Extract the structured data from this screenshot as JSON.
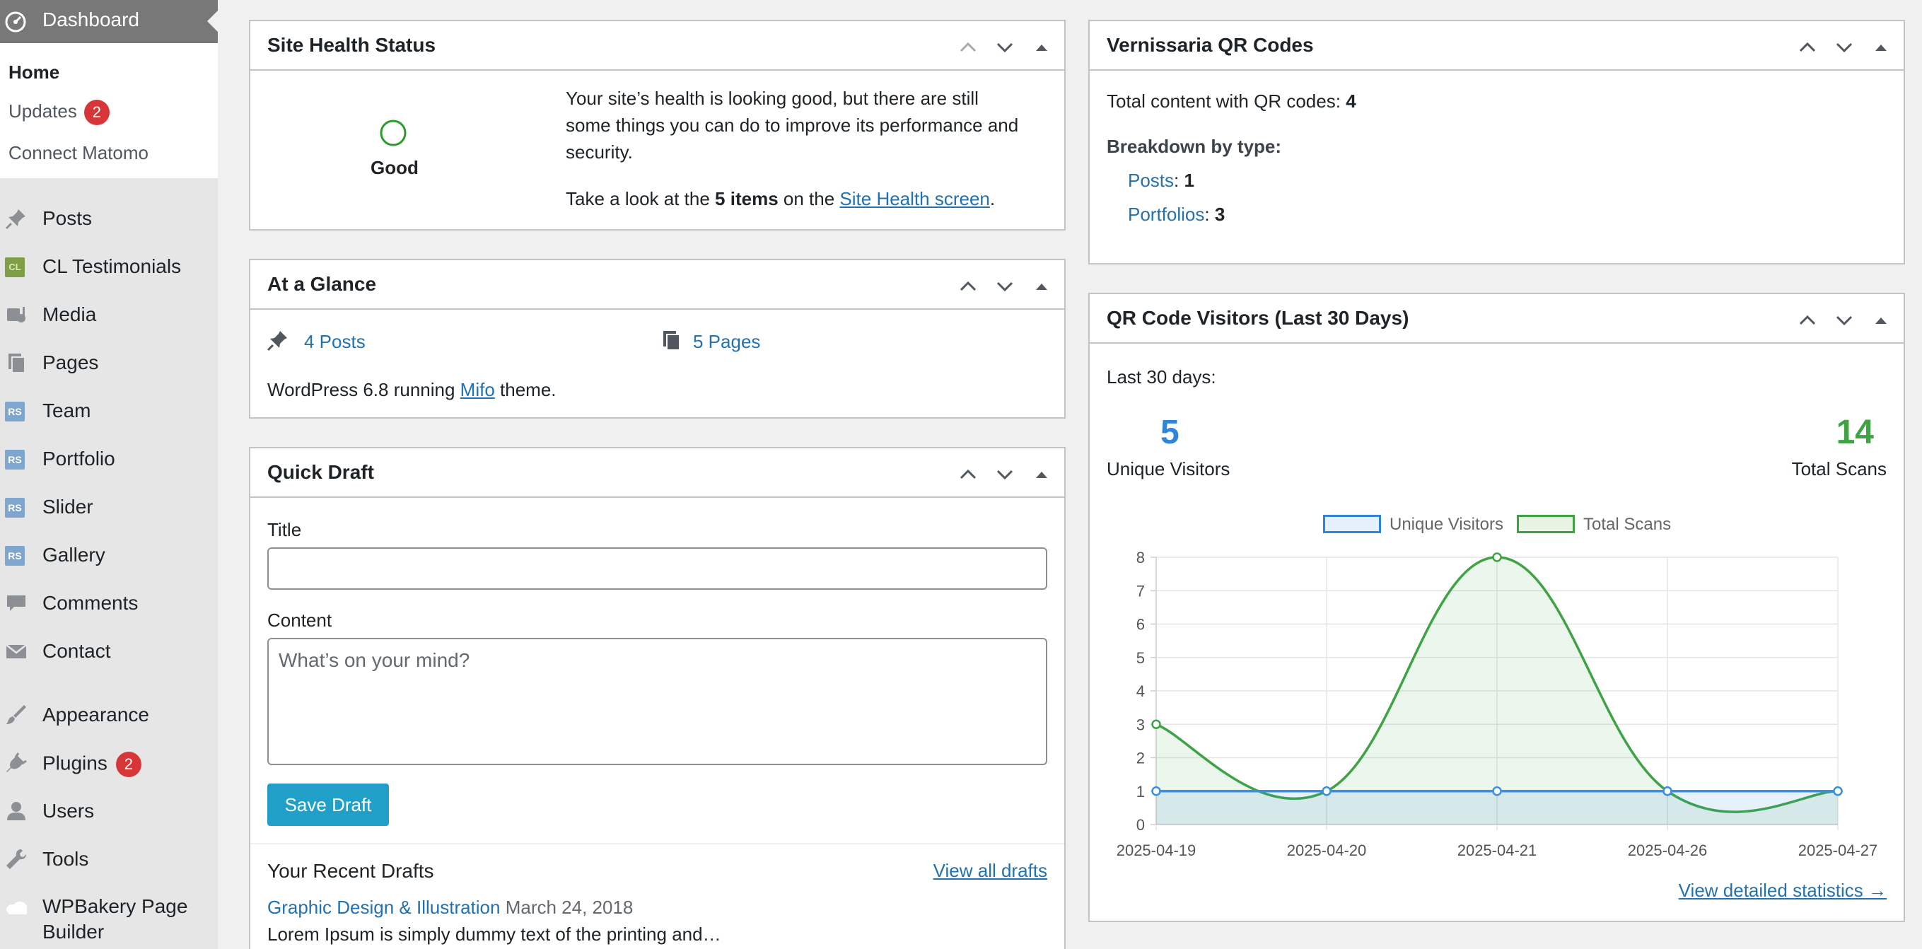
{
  "sidebar": {
    "dashboard_label": "Dashboard",
    "submenu": {
      "home": "Home",
      "updates": "Updates",
      "updates_count": "2",
      "connect_matomo": "Connect Matomo"
    },
    "items": [
      {
        "label": "Posts",
        "icon": "pin-icon"
      },
      {
        "label": "CL Testimonials",
        "icon": "cl-icon"
      },
      {
        "label": "Media",
        "icon": "media-icon"
      },
      {
        "label": "Pages",
        "icon": "pages-icon"
      },
      {
        "label": "Team",
        "icon": "rs-icon"
      },
      {
        "label": "Portfolio",
        "icon": "rs-icon"
      },
      {
        "label": "Slider",
        "icon": "rs-icon"
      },
      {
        "label": "Gallery",
        "icon": "rs-icon"
      },
      {
        "label": "Comments",
        "icon": "comment-icon"
      },
      {
        "label": "Contact",
        "icon": "mail-icon"
      },
      {
        "label": "Appearance",
        "icon": "brush-icon"
      },
      {
        "label": "Plugins",
        "icon": "plug-icon",
        "badge": "2"
      },
      {
        "label": "Users",
        "icon": "user-icon"
      },
      {
        "label": "Tools",
        "icon": "wrench-icon"
      },
      {
        "label": "WPBakery Page",
        "label2": "Builder",
        "icon": "cloud-icon"
      }
    ]
  },
  "site_health": {
    "title": "Site Health Status",
    "status": "Good",
    "message": [
      "Your site’s health is looking good, but there are still",
      "some things you can do to improve its performance and",
      "security."
    ],
    "take_look_prefix": "Take a look at the",
    "items_text": "5 items",
    "on_the": "on the",
    "screen_link": "Site Health screen",
    "period": "."
  },
  "at_a_glance": {
    "title": "At a Glance",
    "posts": "4 Posts",
    "pages": "5 Pages",
    "wp_prefix": "WordPress 6.8 running",
    "theme_link": "Mifo",
    "wp_suffix": "theme."
  },
  "quick_draft": {
    "title": "Quick Draft",
    "title_label": "Title",
    "title_value": "",
    "content_label": "Content",
    "content_placeholder": "What’s on your mind?",
    "save_button": "Save Draft",
    "recent_heading": "Your Recent Drafts",
    "view_all": "View all drafts",
    "draft_title": "Graphic Design & Illustration",
    "draft_date": "March 24, 2018",
    "draft_excerpt": "Lorem Ipsum is simply dummy text of the printing and…"
  },
  "qr_codes": {
    "title": "Vernissaria QR Codes",
    "total_label": "Total content with QR codes:",
    "total_value": "4",
    "breakdown_label": "Breakdown by type:",
    "posts_label": "Posts",
    "posts_value": "1",
    "portfolios_label": "Portfolios",
    "portfolios_value": "3",
    "colon": ":"
  },
  "qr_visitors": {
    "title": "QR Code Visitors (Last 30 Days)",
    "period_label": "Last 30 days:",
    "unique_value": "5",
    "unique_label": "Unique Visitors",
    "scans_value": "14",
    "scans_label": "Total Scans",
    "details_link": "View detailed statistics →"
  },
  "colors": {
    "accent_blue": "#2271b1",
    "badge_red": "#d63638",
    "chart_blue": "#3a8ee6",
    "chart_green": "#3fa345"
  },
  "chart_data": {
    "type": "line",
    "x": [
      "2025-04-19",
      "2025-04-20",
      "2025-04-21",
      "2025-04-26",
      "2025-04-27"
    ],
    "series": [
      {
        "name": "Unique Visitors",
        "values": [
          1,
          1,
          1,
          1,
          1
        ],
        "color": "#3a8ee6"
      },
      {
        "name": "Total Scans",
        "values": [
          3,
          1,
          8,
          1,
          1
        ],
        "color": "#3fa345"
      }
    ],
    "ylim": [
      0,
      8
    ],
    "yticks": [
      "0",
      "1",
      "2",
      "3",
      "4",
      "5",
      "6",
      "7",
      "8"
    ],
    "legend": "top-center",
    "grid": true,
    "fill": "area"
  }
}
